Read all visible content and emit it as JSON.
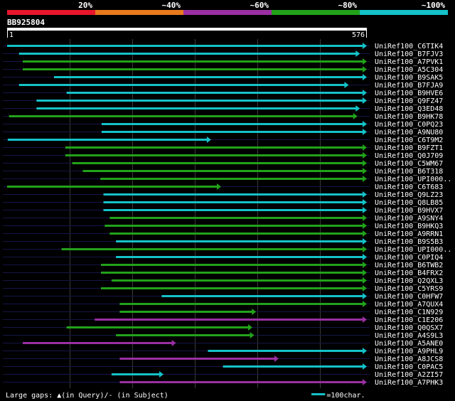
{
  "chart_data": {
    "type": "alignment-overview",
    "query_id": "BB925804",
    "query_start": "1",
    "query_end": "576",
    "query_length": 576,
    "identity_legend": [
      {
        "label": "20%",
        "color": "#e8162c"
      },
      {
        "label": "~40%",
        "color": "#e87a1e"
      },
      {
        "label": "~60%",
        "color": "#9a2fa2"
      },
      {
        "label": "~80%",
        "color": "#22a21a"
      },
      {
        "label": "~100%",
        "color": "#14c2c8"
      }
    ],
    "hits": [
      {
        "name": "UniRef100_C6TIK4",
        "start": 1,
        "end": 576,
        "color": "#14c2c8"
      },
      {
        "name": "UniRef100_B7FJV3",
        "start": 20,
        "end": 565,
        "color": "#14c2c8"
      },
      {
        "name": "UniRef100_A7PVK1",
        "start": 26,
        "end": 576,
        "color": "#22a21a"
      },
      {
        "name": "UniRef100_A5C304",
        "start": 26,
        "end": 576,
        "color": "#22a21a"
      },
      {
        "name": "UniRef100_B9SAK5",
        "start": 76,
        "end": 576,
        "color": "#14c2c8"
      },
      {
        "name": "UniRef100_B7FJA9",
        "start": 20,
        "end": 547,
        "color": "#14c2c8"
      },
      {
        "name": "UniRef100_B9HVE6",
        "start": 96,
        "end": 576,
        "color": "#14c2c8"
      },
      {
        "name": "UniRef100_Q9FZ47",
        "start": 48,
        "end": 576,
        "color": "#14c2c8"
      },
      {
        "name": "UniRef100_Q3ED48",
        "start": 48,
        "end": 565,
        "color": "#14c2c8"
      },
      {
        "name": "UniRef100_B9HK78",
        "start": 4,
        "end": 561,
        "color": "#22a21a"
      },
      {
        "name": "UniRef100_C0PQ23",
        "start": 152,
        "end": 576,
        "color": "#14c2c8"
      },
      {
        "name": "UniRef100_A9NU80",
        "start": 152,
        "end": 576,
        "color": "#14c2c8"
      },
      {
        "name": "UniRef100_C6T9M2",
        "start": 2,
        "end": 327,
        "color": "#14c2c8"
      },
      {
        "name": "UniRef100_B9FZT1",
        "start": 94,
        "end": 576,
        "color": "#22a21a"
      },
      {
        "name": "UniRef100_Q0J709",
        "start": 94,
        "end": 576,
        "color": "#22a21a"
      },
      {
        "name": "UniRef100_C5WM67",
        "start": 105,
        "end": 576,
        "color": "#22a21a"
      },
      {
        "name": "UniRef100_B6T318",
        "start": 122,
        "end": 576,
        "color": "#22a21a"
      },
      {
        "name": "UniRef100_UPI000..",
        "start": 150,
        "end": 576,
        "color": "#22a21a"
      },
      {
        "name": "UniRef100_C6T683",
        "start": 1,
        "end": 343,
        "color": "#22a21a"
      },
      {
        "name": "UniRef100_Q9LZ23",
        "start": 155,
        "end": 576,
        "color": "#14c2c8"
      },
      {
        "name": "UniRef100_Q8LB85",
        "start": 155,
        "end": 576,
        "color": "#14c2c8"
      },
      {
        "name": "UniRef100_B9HVX7",
        "start": 155,
        "end": 576,
        "color": "#14c2c8"
      },
      {
        "name": "UniRef100_A9SNY4",
        "start": 165,
        "end": 576,
        "color": "#22a21a"
      },
      {
        "name": "UniRef100_B9HKQ3",
        "start": 157,
        "end": 576,
        "color": "#22a21a"
      },
      {
        "name": "UniRef100_A9RRN1",
        "start": 165,
        "end": 576,
        "color": "#22a21a"
      },
      {
        "name": "UniRef100_B9S5B3",
        "start": 175,
        "end": 576,
        "color": "#14c2c8"
      },
      {
        "name": "UniRef100_UPI000..",
        "start": 88,
        "end": 576,
        "color": "#22a21a"
      },
      {
        "name": "UniRef100_C0PIQ4",
        "start": 175,
        "end": 576,
        "color": "#14c2c8"
      },
      {
        "name": "UniRef100_B6TWB2",
        "start": 151,
        "end": 576,
        "color": "#22a21a"
      },
      {
        "name": "UniRef100_B4FRX2",
        "start": 151,
        "end": 576,
        "color": "#22a21a"
      },
      {
        "name": "UniRef100_Q2QXL3",
        "start": 168,
        "end": 576,
        "color": "#22a21a"
      },
      {
        "name": "UniRef100_C5YRS9",
        "start": 151,
        "end": 576,
        "color": "#22a21a"
      },
      {
        "name": "UniRef100_C0HFW7",
        "start": 248,
        "end": 576,
        "color": "#14c2c8"
      },
      {
        "name": "UniRef100_A7QUX4",
        "start": 181,
        "end": 576,
        "color": "#22a21a"
      },
      {
        "name": "UniRef100_C1N929",
        "start": 181,
        "end": 399,
        "color": "#22a21a"
      },
      {
        "name": "UniRef100_C1E206",
        "start": 141,
        "end": 576,
        "color": "#9a2fa2"
      },
      {
        "name": "UniRef100_Q0QSX7",
        "start": 96,
        "end": 393,
        "color": "#22a21a"
      },
      {
        "name": "UniRef100_A4S9L3",
        "start": 175,
        "end": 396,
        "color": "#22a21a"
      },
      {
        "name": "UniRef100_A5ANE0",
        "start": 26,
        "end": 271,
        "color": "#9a2fa2"
      },
      {
        "name": "UniRef100_A9PHL9",
        "start": 322,
        "end": 576,
        "color": "#14c2c8"
      },
      {
        "name": "UniRef100_A8JCS8",
        "start": 181,
        "end": 435,
        "color": "#9a2fa2"
      },
      {
        "name": "UniRef100_C0PAC5",
        "start": 346,
        "end": 576,
        "color": "#14c2c8"
      },
      {
        "name": "UniRef100_A2ZI57",
        "start": 168,
        "end": 251,
        "color": "#14c2c8"
      },
      {
        "name": "UniRef100_A7PHK3",
        "start": 181,
        "end": 576,
        "color": "#9a2fa2"
      }
    ],
    "footer_gap_note": "Large gaps: ▲(in Query)/- (in Subject)",
    "scale_label": "=100char."
  }
}
